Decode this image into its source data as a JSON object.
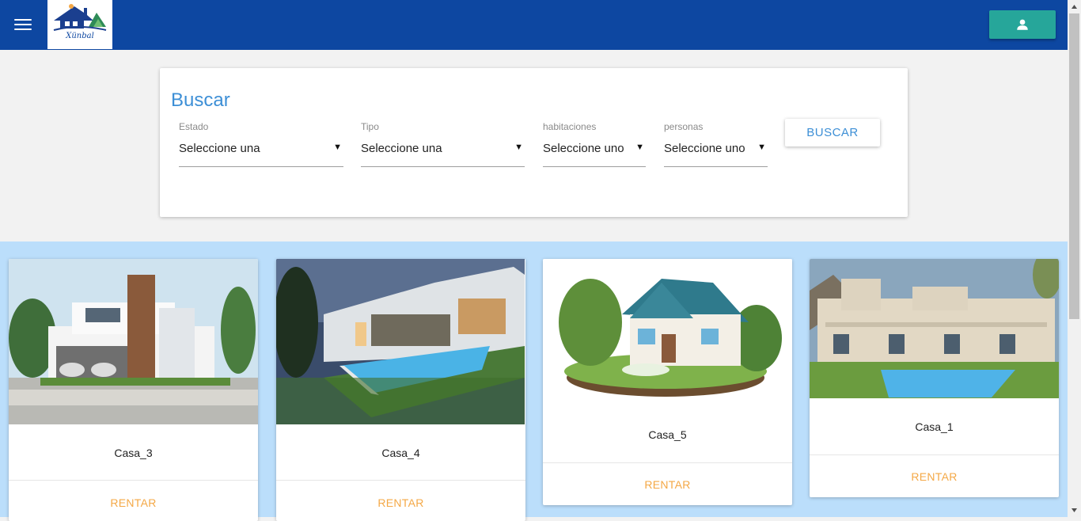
{
  "app": {
    "logo_text": "Xünbal"
  },
  "header": {
    "menu_icon": "menu-icon",
    "user_icon": "person-icon"
  },
  "search": {
    "title": "Buscar",
    "fields": [
      {
        "label": "Estado",
        "value": "Seleccione una"
      },
      {
        "label": "Tipo",
        "value": "Seleccione una"
      },
      {
        "label": "habitaciones",
        "value": "Seleccione uno"
      },
      {
        "label": "personas",
        "value": "Seleccione uno"
      }
    ],
    "button_label": "BUSCAR"
  },
  "listings": [
    {
      "name": "Casa_3",
      "action": "RENTAR"
    },
    {
      "name": "Casa_4",
      "action": "RENTAR"
    },
    {
      "name": "Casa_5",
      "action": "RENTAR"
    },
    {
      "name": "Casa_1",
      "action": "RENTAR"
    }
  ],
  "colors": {
    "header": "#0d47a1",
    "accent": "#26a69a",
    "link": "#3d8fd6",
    "action": "#f4a846",
    "listing_bg": "#bbdefb"
  }
}
